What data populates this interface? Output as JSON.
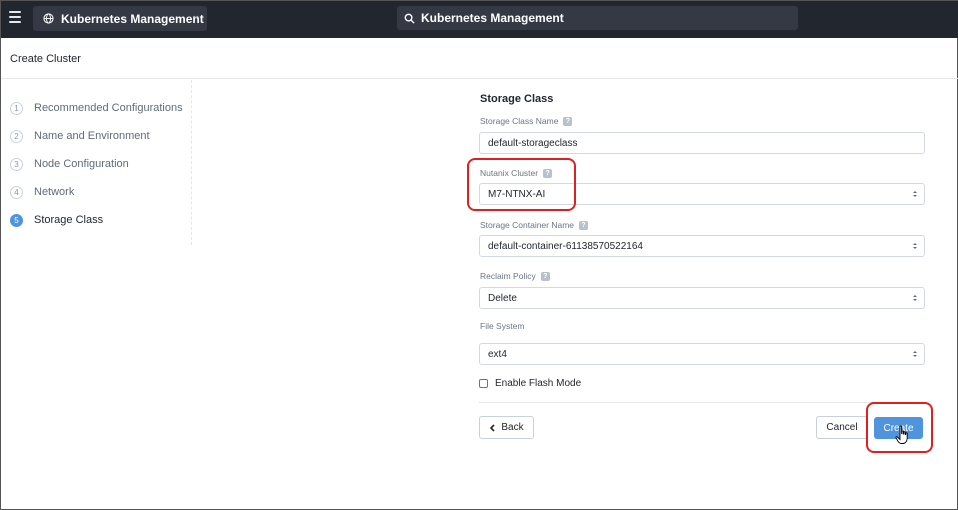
{
  "topbar": {
    "app_name": "Kubernetes Management",
    "search_text": "Kubernetes Management"
  },
  "page": {
    "title": "Create Cluster"
  },
  "steps": [
    {
      "number": "1",
      "label": "Recommended Configurations",
      "active": false
    },
    {
      "number": "2",
      "label": "Name and Environment",
      "active": false
    },
    {
      "number": "3",
      "label": "Node Configuration",
      "active": false
    },
    {
      "number": "4",
      "label": "Network",
      "active": false
    },
    {
      "number": "5",
      "label": "Storage Class",
      "active": true
    }
  ],
  "form": {
    "section_title": "Storage Class",
    "storage_class_name": {
      "label": "Storage Class Name",
      "value": "default-storageclass"
    },
    "nutanix_cluster": {
      "label": "Nutanix Cluster",
      "value": "M7-NTNX-AI"
    },
    "storage_container_name": {
      "label": "Storage Container Name",
      "value": "default-container-61138570522164"
    },
    "reclaim_policy": {
      "label": "Reclaim Policy",
      "value": "Delete"
    },
    "file_system": {
      "label": "File System",
      "value": "ext4"
    },
    "enable_flash_mode": {
      "label": "Enable Flash Mode",
      "checked": false
    }
  },
  "buttons": {
    "back": "Back",
    "cancel": "Cancel",
    "create": "Create"
  },
  "icons": {
    "menu": "hamburger-icon",
    "app": "globe-icon",
    "search": "search-icon",
    "help": "help-icon",
    "select": "select-caret-icon",
    "back": "chevron-left-icon",
    "cursor": "hand-pointer-icon"
  },
  "colors": {
    "topbar": "#22262f",
    "accent": "#4f94dd",
    "annotation": "#e0201f",
    "help_mark": "?"
  }
}
